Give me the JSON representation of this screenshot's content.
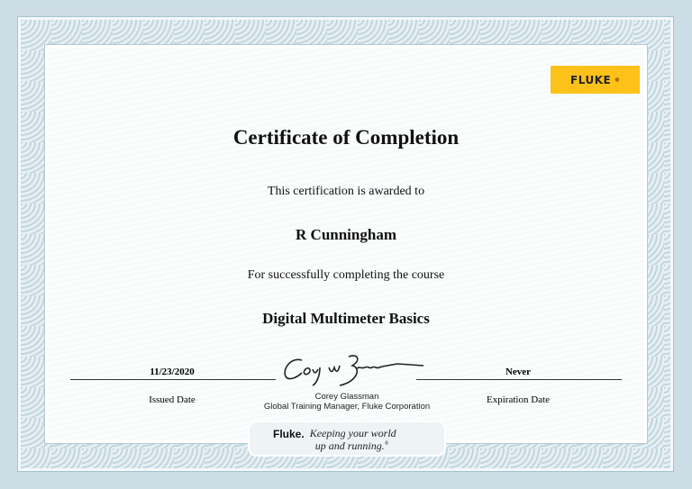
{
  "logo": {
    "text": "FLUKE",
    "brand_color": "#fcc21a"
  },
  "certificate": {
    "title": "Certificate of Completion",
    "awarded_text": "This certification is awarded to",
    "recipient": "R Cunningham",
    "course_text": "For successfully completing the course",
    "course": "Digital Multimeter Basics"
  },
  "issued": {
    "value": "11/23/2020",
    "label": "Issued Date"
  },
  "expiration": {
    "value": "Never",
    "label": "Expiration Date"
  },
  "signatory": {
    "name": "Corey Glassman",
    "title": "Global Training Manager, Fluke Corporation"
  },
  "banner": {
    "brand": "Fluke.",
    "tagline_line1": "Keeping your world",
    "tagline_line2": "up and running.",
    "mark": "®"
  }
}
